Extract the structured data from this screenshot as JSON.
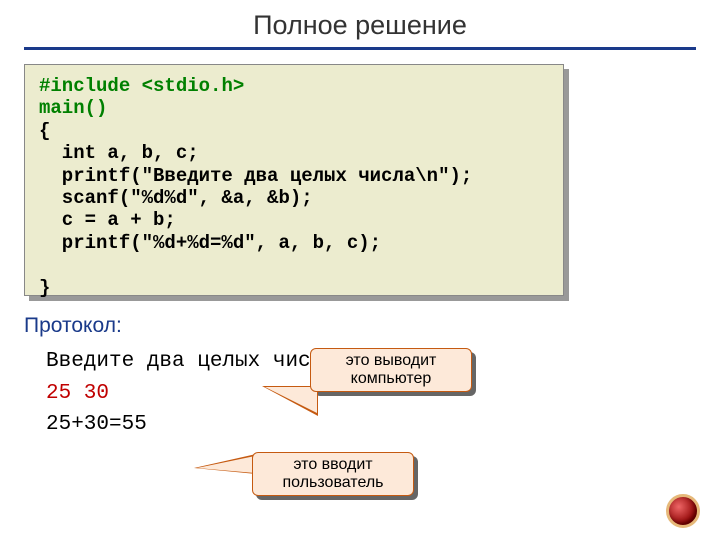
{
  "title": "Полное решение",
  "code": {
    "line1a": "#include ",
    "line1b": "<stdio.h>",
    "line2": "main()",
    "line3": "{",
    "line4": "  int a, b, c;",
    "line5": "  printf(\"Введите два целых числа\\n\");",
    "line6": "  scanf(\"%d%d\", &a, &b);",
    "line7": "  c = a + b;",
    "line8": "  printf(\"%d+%d=%d\", a, b, c);",
    "line9": "",
    "line10": "}"
  },
  "protocol_label": "Протокол:",
  "protocol": {
    "prompt": "Введите два целых числа",
    "input": "25 30",
    "output": "25+30=55"
  },
  "callout1": "это выводит компьютер",
  "callout2": "это вводит пользователь"
}
